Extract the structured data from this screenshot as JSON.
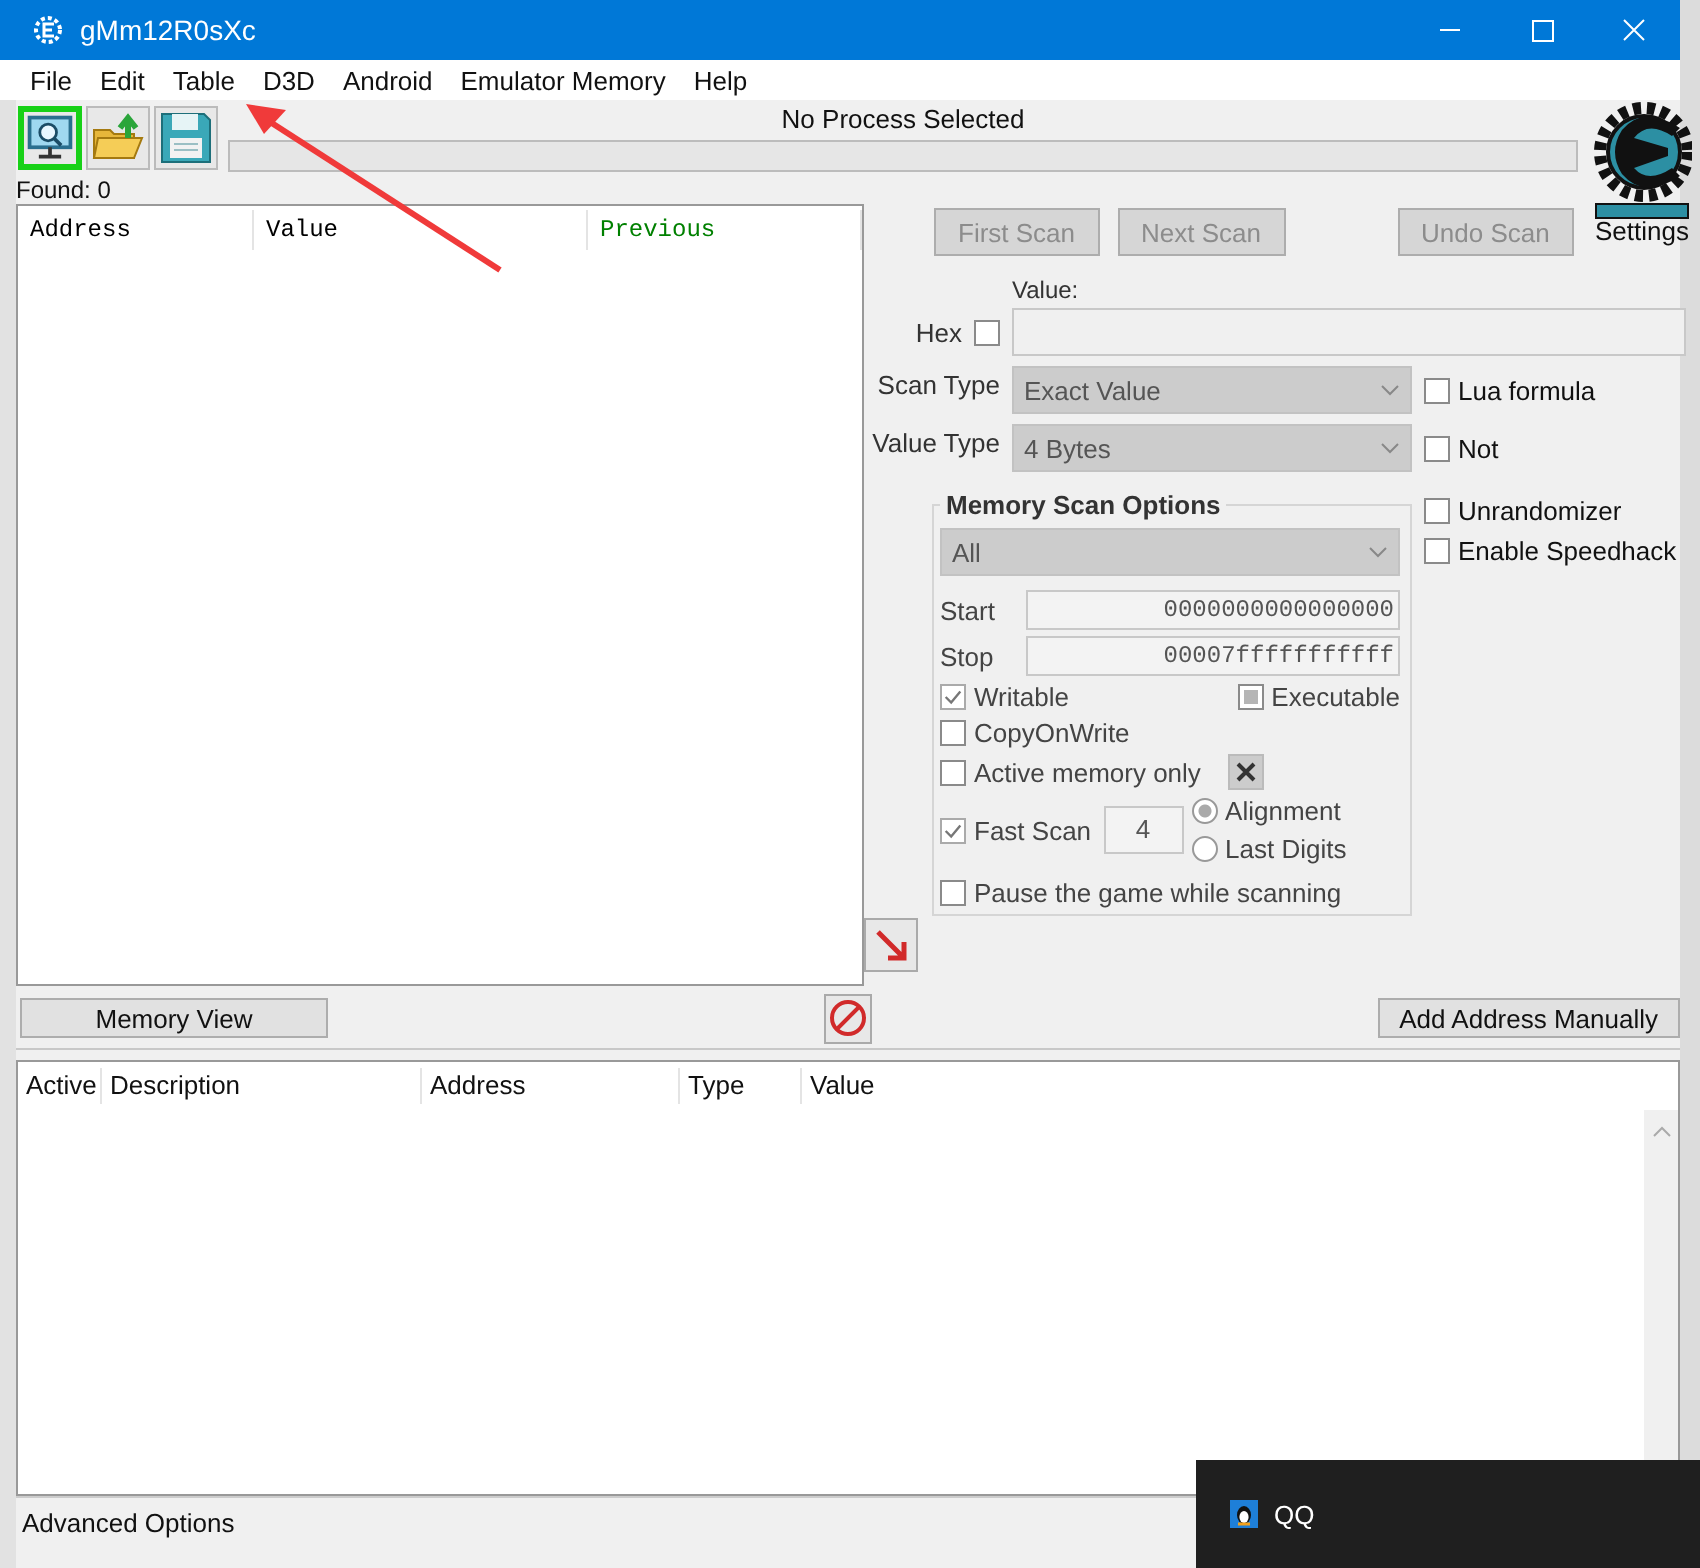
{
  "window": {
    "title": "gMm12R0sXc"
  },
  "menu": [
    "File",
    "Edit",
    "Table",
    "D3D",
    "Android",
    "Emulator Memory",
    "Help"
  ],
  "toolbar": {
    "buttons": [
      {
        "kind": "process",
        "selected": true
      },
      {
        "kind": "open",
        "selected": false
      },
      {
        "kind": "save",
        "selected": false
      }
    ],
    "process_label": "No Process Selected",
    "progress": {
      "level": 0
    }
  },
  "found": "Found: 0",
  "settings_label": "Settings",
  "results": {
    "columns": [
      {
        "label": "Address",
        "color": "#000000"
      },
      {
        "label": "Value",
        "color": "#000000"
      },
      {
        "label": "Previous",
        "color": "#008000"
      }
    ]
  },
  "scan_buttons": [
    {
      "label": "First Scan",
      "disabled": true
    },
    {
      "label": "Next Scan",
      "disabled": true
    },
    {
      "label": "Undo Scan",
      "disabled": true
    }
  ],
  "value": {
    "label": "Value:",
    "hex": {
      "label": "Hex",
      "checked": false
    }
  },
  "scan_type": {
    "label": "Scan Type",
    "value": "Exact Value"
  },
  "value_type": {
    "label": "Value Type",
    "value": "4 Bytes"
  },
  "side_options": [
    {
      "label": "Lua formula",
      "checked": false
    },
    {
      "label": "Not",
      "checked": false
    },
    {
      "label": "Unrandomizer",
      "checked": false
    },
    {
      "label": "Enable Speedhack",
      "checked": false
    }
  ],
  "memory_scan_options": {
    "title": "Memory Scan Options",
    "region": "All",
    "start": {
      "label": "Start",
      "value": "0000000000000000"
    },
    "stop": {
      "label": "Stop",
      "value": "00007fffffffffff"
    },
    "writable": {
      "label": "Writable",
      "checked": true
    },
    "executable": {
      "label": "Executable",
      "checked": false,
      "mixed": true
    },
    "copy_on_write": {
      "label": "CopyOnWrite",
      "checked": false
    },
    "active_memory_only": {
      "label": "Active memory only",
      "checked": false
    },
    "fast_scan": {
      "label": "Fast Scan",
      "checked": true,
      "value": "4"
    },
    "alignment_options": [
      {
        "label": "Alignment",
        "selected": true
      },
      {
        "label": "Last Digits",
        "selected": false
      }
    ],
    "pause": {
      "label": "Pause the game while scanning",
      "checked": false
    }
  },
  "memory_view_button": "Memory View",
  "add_address_button": "Add Address Manually",
  "address_list": {
    "columns": [
      "Active",
      "Description",
      "Address",
      "Type",
      "Value"
    ]
  },
  "advanced_options": "Advanced Options",
  "notification": {
    "label": "QQ"
  }
}
